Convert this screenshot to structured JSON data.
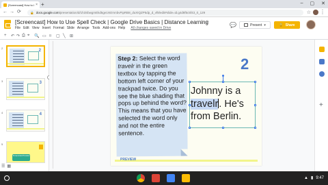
{
  "browser": {
    "tab_title": "[Screencast] How to Use Spell",
    "tab_close": "×",
    "new_tab": "+",
    "window_controls": [
      "–",
      "▢",
      "✕"
    ],
    "url_domain": "docs.google.com",
    "url_path": "/presentation/d/1h3SbwgmEkd5ge1WzmnbvFtpRB8_duXIQZP5dp_d_vf8/edit#slide=id.g4d8f5c5f43_0_129",
    "back": "←",
    "forward": "→",
    "reload": "⟳",
    "menu": "⋮"
  },
  "docs": {
    "title": "[Screencast] How to Use Spell Check | Google Drive Basics | Distance Learning",
    "star": "☆",
    "menu": [
      "File",
      "Edit",
      "View",
      "Insert",
      "Format",
      "Slide",
      "Arrange",
      "Tools",
      "Add-ons",
      "Help"
    ],
    "edit_note": "All changes saved in Drive",
    "comment": "💬",
    "present_label": "Present",
    "present_caret": "▾",
    "share_label": "Share",
    "share_icon": "🔒"
  },
  "toolbar": {
    "icons": [
      "+",
      "↶",
      "↷",
      "⎙",
      "⌖",
      "🔍",
      "▭",
      "⌑",
      "▢",
      "╲",
      "⊞"
    ]
  },
  "filmstrip": {
    "slide_numbers": [
      "2",
      "3",
      "4",
      "5"
    ],
    "thumb_numbers": [
      "2",
      "3",
      "4"
    ],
    "thumb_lines": [
      "Johnny is a",
      "travelr. He's",
      "from Berlin."
    ],
    "last_thumb_button": "Screencast Preview",
    "controls": [
      "☰",
      "▦"
    ]
  },
  "slide": {
    "note": {
      "step_label": "Step 2:",
      "text_1": " Select the word ",
      "word": "travelr",
      "text_2": " in the green textbox by tapping the bottom left corner of your trackpad twice. Do you see the blue shading that pops up behind the word? This means that you have selected the word only and not the entire sentence."
    },
    "number": "2",
    "textbox": {
      "line_1": "Johnny is a",
      "selected_word": "travelr",
      "line_2_rest": ". He's",
      "line_3": "from Berlin."
    },
    "strip_label": "PREVIEW"
  },
  "taskbar": {
    "time": "9:47",
    "wifi": "▲",
    "battery": "▮"
  },
  "colors": {
    "accent": "#f4b400",
    "note_blue": "#d5e4f4",
    "textbox_teal": "#6bb8b3",
    "slide_number_blue": "#4a78c8",
    "selection_blue": "#c6d9f5"
  }
}
